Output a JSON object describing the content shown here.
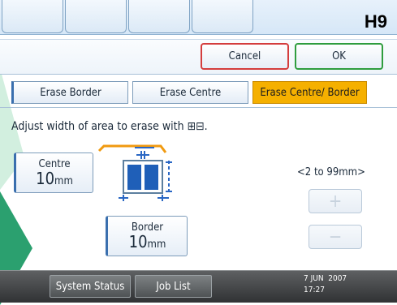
{
  "corner_label": "H9",
  "actions": {
    "cancel": "Cancel",
    "ok": "OK"
  },
  "modes": [
    "Erase Border",
    "Erase Centre",
    "Erase Centre/ Border"
  ],
  "selected_mode": "Erase Centre/ Border",
  "instruction": "Adjust width of area to erase with ⊞⊟.",
  "centre": {
    "label": "Centre",
    "value": "10",
    "unit": "mm"
  },
  "border": {
    "label": "Border",
    "value": "10",
    "unit": "mm"
  },
  "range": "<2 to 99mm>",
  "stepper": {
    "plus": "+",
    "minus": "−"
  },
  "statusbar": {
    "system_status": "System Status",
    "job_list": "Job List",
    "date": "7 JUN  2007",
    "time": "17:27"
  },
  "colors": {
    "selected_tab": "#f5b000",
    "cancel_border": "#d43d3d",
    "ok_border": "#2f9d3e",
    "diagram_blue": "#1f5fb8"
  },
  "icons": [
    "page-erase-diagram-icon",
    "plus-icon",
    "minus-icon"
  ]
}
